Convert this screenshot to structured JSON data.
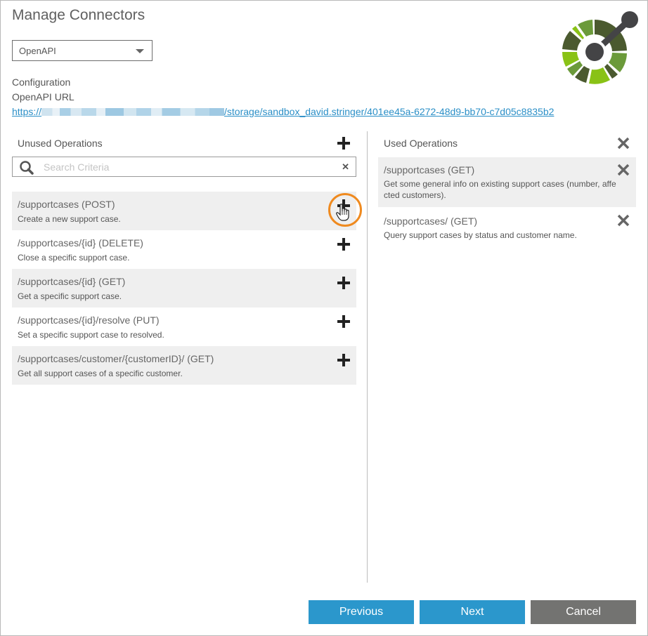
{
  "dialog": {
    "title": "Manage Connectors",
    "connector_type": {
      "selected": "OpenAPI"
    },
    "config_label": "Configuration",
    "url_label": "OpenAPI URL",
    "url": {
      "prefix": "https://",
      "redacted": true,
      "suffix": "/storage/sandbox_david.stringer/401ee45a-6272-48d9-bb70-c7d05c8835b2"
    },
    "logo_icon": "openapi-logo"
  },
  "unused": {
    "title": "Unused Operations",
    "add_all_icon": "plus-icon",
    "search": {
      "placeholder": "Search Criteria",
      "value": ""
    },
    "items": [
      {
        "name": "/supportcases (POST)",
        "desc": "Create a new support case.",
        "highlighted": true
      },
      {
        "name": "/supportcases/{id} (DELETE)",
        "desc": "Close a specific support case."
      },
      {
        "name": "/supportcases/{id} (GET)",
        "desc": "Get a specific support case."
      },
      {
        "name": "/supportcases/{id}/resolve (PUT)",
        "desc": "Set a specific support case to resolved."
      },
      {
        "name": "/supportcases/customer/{customerID}/ (GET)",
        "desc": "Get all support cases of a specific customer."
      }
    ]
  },
  "used": {
    "title": "Used Operations",
    "remove_all_icon": "close-icon",
    "items": [
      {
        "name": "/supportcases (GET)",
        "desc": "Get some general info on existing support cases (number, affe cted customers)."
      },
      {
        "name": "/supportcases/ (GET)",
        "desc": "Query support cases by status and customer name."
      }
    ]
  },
  "footer": {
    "previous": "Previous",
    "next": "Next",
    "cancel": "Cancel"
  },
  "colors": {
    "accent": "#2b97cc",
    "cancel": "#737371",
    "highlight_ring": "#ef8a1f",
    "link": "#2b8fc7"
  }
}
